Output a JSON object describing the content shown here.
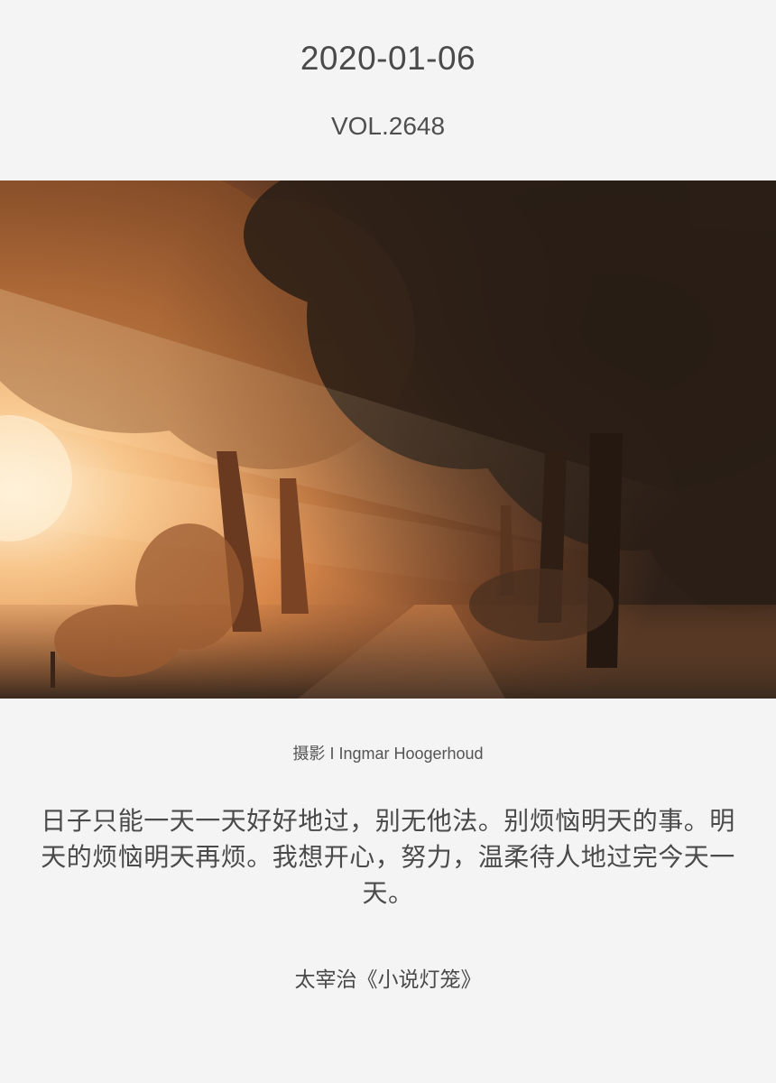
{
  "header": {
    "date": "2020-01-06",
    "volume": "VOL.2648"
  },
  "photo": {
    "alt": "",
    "colors": {
      "sky_glow": "#f7c98e",
      "sun": "#fff1d6",
      "fog_mid": "#d98a4a",
      "canopy_dark": "#2b1f17",
      "canopy_warm": "#6b3f22",
      "ground": "#4a3526"
    }
  },
  "credit": {
    "text": "摄影 I Ingmar Hoogerhoud"
  },
  "quote": {
    "text": "日子只能一天一天好好地过，别无他法。别烦恼明天的事。明天的烦恼明天再烦。我想开心，努力，温柔待人地过完今天一天。"
  },
  "source": {
    "text": "太宰治《小说灯笼》"
  }
}
